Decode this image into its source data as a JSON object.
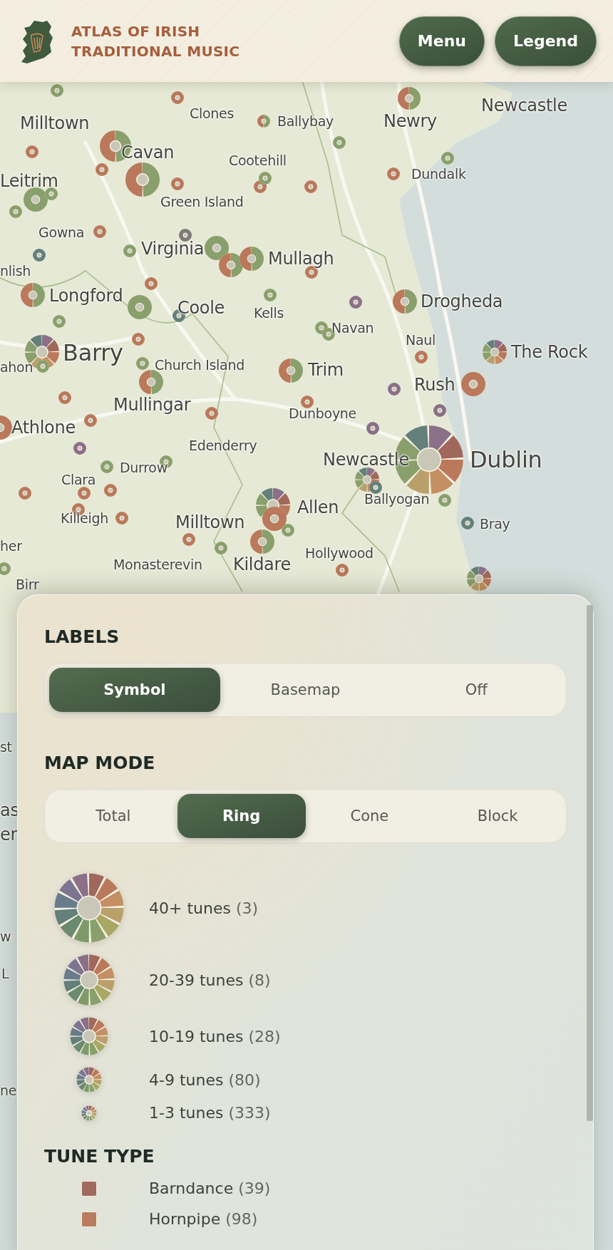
{
  "header": {
    "title": "ATLAS OF IRISH TRADITIONAL MUSIC",
    "buttons": [
      "Menu",
      "Legend"
    ]
  },
  "map": {
    "place_labels": [
      {
        "name": "Milltown",
        "kind": "town"
      },
      {
        "name": "Clones",
        "kind": "village"
      },
      {
        "name": "Ballybay",
        "kind": "village"
      },
      {
        "name": "Newry",
        "kind": "town"
      },
      {
        "name": "Newcastle",
        "kind": "town"
      },
      {
        "name": "Cavan",
        "kind": "town"
      },
      {
        "name": "Cootehill",
        "kind": "village"
      },
      {
        "name": "Dundalk",
        "kind": "village"
      },
      {
        "name": "Leitrim",
        "kind": "town"
      },
      {
        "name": "Green Island",
        "kind": "village"
      },
      {
        "name": "Gowna",
        "kind": "village"
      },
      {
        "name": "Virginia",
        "kind": "town"
      },
      {
        "name": "Mullagh",
        "kind": "town"
      },
      {
        "name": "nlish",
        "kind": "village"
      },
      {
        "name": "Longford",
        "kind": "town"
      },
      {
        "name": "Coole",
        "kind": "town"
      },
      {
        "name": "Kells",
        "kind": "village"
      },
      {
        "name": "Drogheda",
        "kind": "town"
      },
      {
        "name": "Navan",
        "kind": "village"
      },
      {
        "name": "Naul",
        "kind": "village"
      },
      {
        "name": "The Rock",
        "kind": "town"
      },
      {
        "name": "Barry",
        "kind": "city"
      },
      {
        "name": "ahon",
        "kind": "village"
      },
      {
        "name": "Church Island",
        "kind": "village"
      },
      {
        "name": "Trim",
        "kind": "town"
      },
      {
        "name": "Rush",
        "kind": "town"
      },
      {
        "name": "Mullingar",
        "kind": "town"
      },
      {
        "name": "Dunboyne",
        "kind": "village"
      },
      {
        "name": "Athlone",
        "kind": "town"
      },
      {
        "name": "Edenderry",
        "kind": "village"
      },
      {
        "name": "Newcastle",
        "kind": "town"
      },
      {
        "name": "Dublin",
        "kind": "city"
      },
      {
        "name": "Durrow",
        "kind": "village"
      },
      {
        "name": "Clara",
        "kind": "village"
      },
      {
        "name": "Ballyogan",
        "kind": "village"
      },
      {
        "name": "Killeigh",
        "kind": "village"
      },
      {
        "name": "Allen",
        "kind": "town"
      },
      {
        "name": "Milltown",
        "kind": "town"
      },
      {
        "name": "Bray",
        "kind": "village"
      },
      {
        "name": "her",
        "kind": "village"
      },
      {
        "name": "Hollywood",
        "kind": "village"
      },
      {
        "name": "Monasterevin",
        "kind": "village"
      },
      {
        "name": "Kildare",
        "kind": "town"
      },
      {
        "name": "Birr",
        "kind": "village"
      },
      {
        "name": "st",
        "kind": "village"
      },
      {
        "name": "as",
        "kind": "town"
      },
      {
        "name": "er",
        "kind": "town"
      },
      {
        "name": "w",
        "kind": "village"
      },
      {
        "name": "L",
        "kind": "village"
      },
      {
        "name": "ne",
        "kind": "village"
      }
    ]
  },
  "legend": {
    "labels": {
      "title": "LABELS",
      "options": [
        {
          "label": "Symbol",
          "selected": true
        },
        {
          "label": "Basemap",
          "selected": false
        },
        {
          "label": "Off",
          "selected": false
        }
      ]
    },
    "map_mode": {
      "title": "MAP MODE",
      "options": [
        {
          "label": "Total",
          "selected": false
        },
        {
          "label": "Ring",
          "selected": true
        },
        {
          "label": "Cone",
          "selected": false
        },
        {
          "label": "Block",
          "selected": false
        }
      ]
    },
    "size_classes": [
      {
        "label": "40+ tunes",
        "count": "(3)"
      },
      {
        "label": "20-39 tunes",
        "count": "(8)"
      },
      {
        "label": "10-19 tunes",
        "count": "(28)"
      },
      {
        "label": "4-9 tunes",
        "count": "(80)"
      },
      {
        "label": "1-3 tunes",
        "count": "(333)"
      }
    ],
    "tune_type": {
      "title": "TUNE TYPE",
      "items": [
        {
          "label": "Barndance",
          "count": "(39)",
          "color": "#a06a5c"
        },
        {
          "label": "Hornpipe",
          "count": "(98)",
          "color": "#b97c5e"
        }
      ]
    }
  }
}
